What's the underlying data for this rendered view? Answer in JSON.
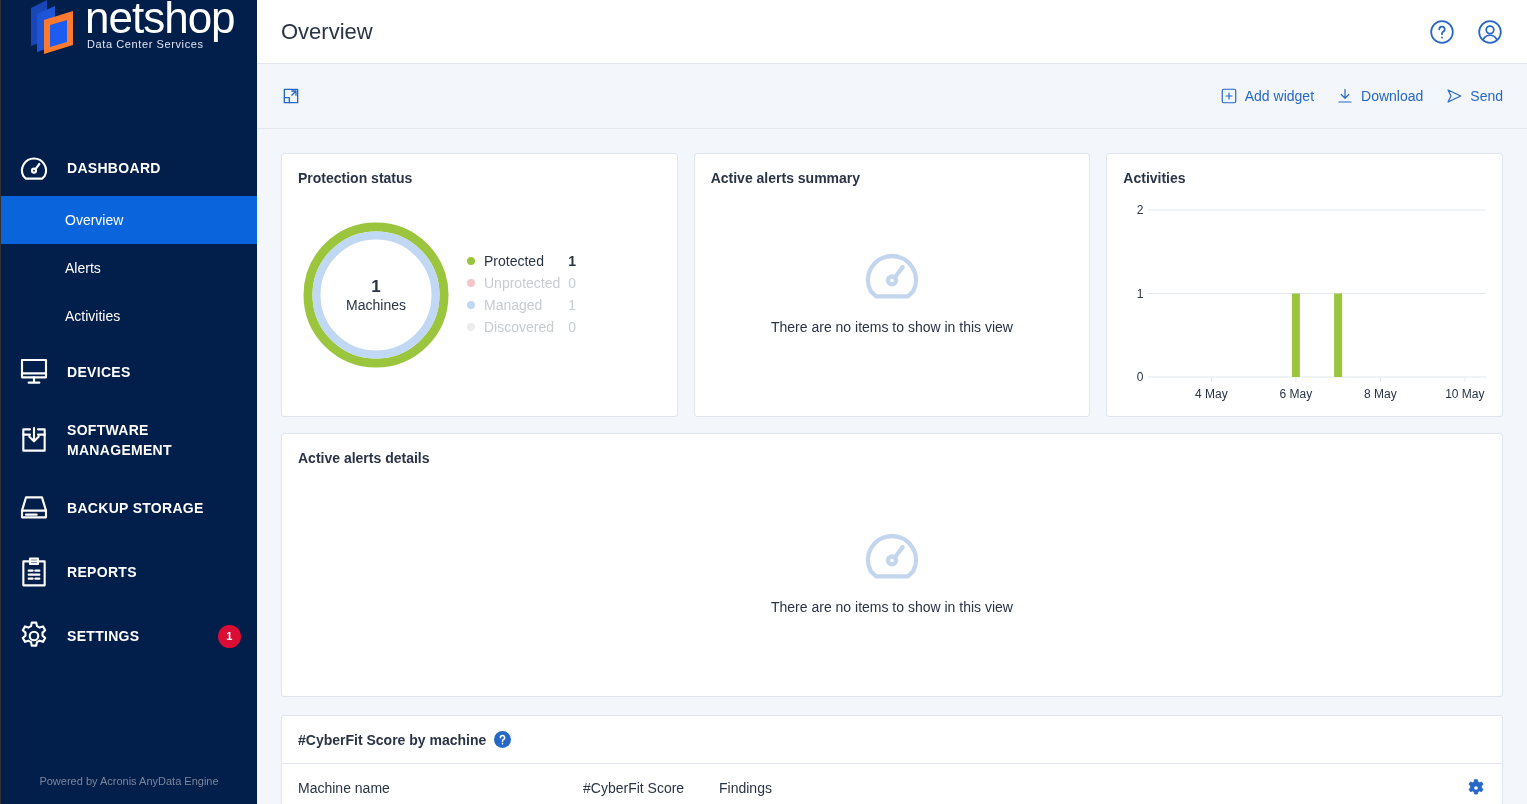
{
  "brand": {
    "name": "netshop",
    "tagline": "Data Center Services"
  },
  "sidebar": {
    "sections": [
      {
        "kind": "dashboard",
        "label": "DASHBOARD",
        "children": [
          {
            "label": "Overview",
            "selected": true
          },
          {
            "label": "Alerts",
            "selected": false
          },
          {
            "label": "Activities",
            "selected": false
          }
        ]
      },
      {
        "kind": "devices",
        "label": "DEVICES"
      },
      {
        "kind": "software",
        "label": "SOFTWARE MANAGEMENT"
      },
      {
        "kind": "storage",
        "label": "BACKUP STORAGE"
      },
      {
        "kind": "reports",
        "label": "REPORTS"
      },
      {
        "kind": "settings",
        "label": "SETTINGS",
        "badge": "1"
      }
    ],
    "footer": "Powered by Acronis AnyData Engine"
  },
  "header": {
    "title": "Overview"
  },
  "toolbar": {
    "actions": [
      {
        "kind": "add",
        "label": "Add widget"
      },
      {
        "kind": "download",
        "label": "Download"
      },
      {
        "kind": "send",
        "label": "Send"
      }
    ]
  },
  "protection_status": {
    "title": "Protection status",
    "total": "1",
    "total_label": "Machines",
    "legend": [
      {
        "label": "Protected",
        "count": "1",
        "color": "#9bc53d",
        "disabled": false
      },
      {
        "label": "Unprotected",
        "count": "0",
        "color": "#f3c6c9",
        "disabled": true
      },
      {
        "label": "Managed",
        "count": "1",
        "color": "#c0d8f3",
        "disabled": true
      },
      {
        "label": "Discovered",
        "count": "0",
        "color": "#ececec",
        "disabled": true
      }
    ]
  },
  "alerts_summary": {
    "title": "Active alerts summary",
    "message": "There are no items to show in this view"
  },
  "activities": {
    "title": "Activities",
    "chart_data": {
      "type": "bar",
      "categories": [
        null,
        "4 May",
        null,
        "6 May",
        null,
        "8 May",
        null,
        "10 May"
      ],
      "series": [
        {
          "color": "#9bc53d",
          "values": [
            0,
            0,
            0,
            1,
            1,
            0,
            0,
            0
          ]
        }
      ],
      "ylim": [
        0,
        2
      ],
      "yticks": [
        0,
        1,
        2
      ]
    }
  },
  "alerts_details": {
    "title": "Active alerts details",
    "message": "There are no items to show in this view"
  },
  "cyberfit": {
    "title": "#CyberFit Score by machine",
    "columns": [
      "Machine name",
      "#CyberFit Score",
      "Findings"
    ]
  }
}
